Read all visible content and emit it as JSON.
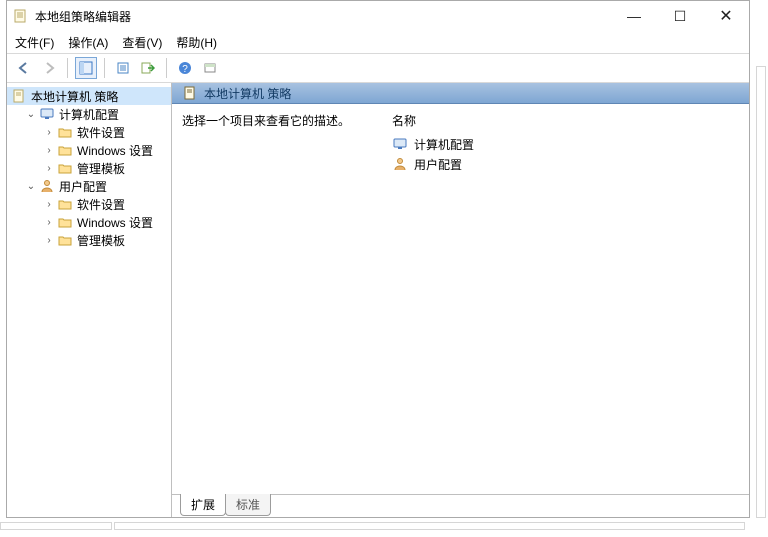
{
  "title": "本地组策略编辑器",
  "menu": {
    "file": "文件(F)",
    "action": "操作(A)",
    "view": "查看(V)",
    "help": "帮助(H)"
  },
  "winctrl": {
    "min": "—",
    "max": "☐",
    "close": "✕"
  },
  "tree": {
    "root": "本地计算机 策略",
    "computer": "计算机配置",
    "user": "用户配置",
    "software": "软件设置",
    "windows": "Windows 设置",
    "admin": "管理模板"
  },
  "header": "本地计算机 策略",
  "desc": "选择一个项目来查看它的描述。",
  "col_name": "名称",
  "items": {
    "computer": "计算机配置",
    "user": "用户配置"
  },
  "tabs": {
    "extended": "扩展",
    "standard": "标准"
  }
}
